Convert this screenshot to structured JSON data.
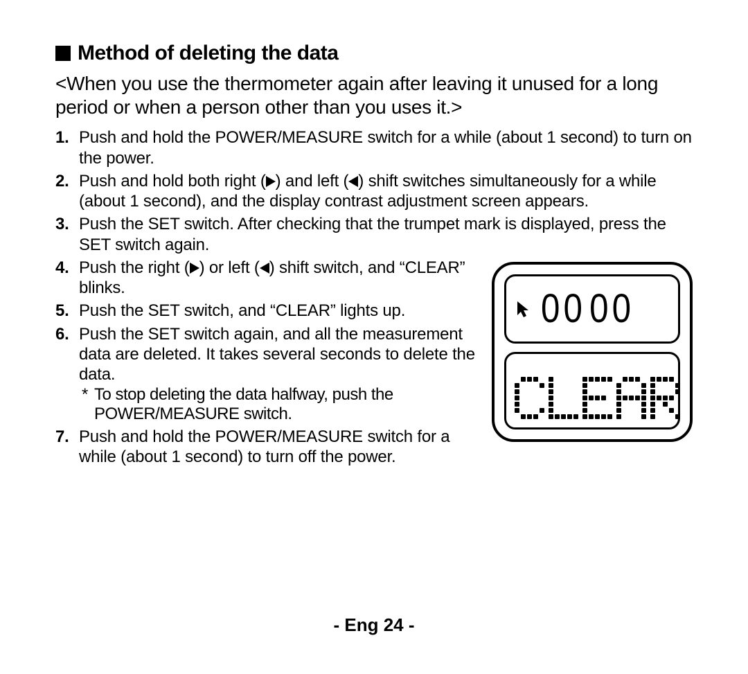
{
  "title": "Method of deleting the data",
  "intro": "<When you use the thermometer again after leaving it unused for a long period or when a person other than you uses it.>",
  "steps": {
    "s1": "Push and hold the POWER/MEASURE switch for a while (about 1 second) to turn on the power.",
    "s2a": "Push and hold both right (",
    "s2b": ") and left (",
    "s2c": ") shift switches simultaneously for a while (about 1 second), and the display contrast adjustment screen appears.",
    "s3": "Push the SET switch. After checking that the trumpet mark is displayed, press the SET switch again.",
    "s4a": "Push the right (",
    "s4b": ") or left (",
    "s4c": ") shift switch, and “CLEAR” blinks.",
    "s5": "Push the SET switch, and “CLEAR” lights up.",
    "s6": "Push the SET switch again, and all the measurement data are deleted. It takes several seconds to delete the data.",
    "s6_note": "To stop deleting the data halfway, push the POWER/MEASURE switch.",
    "s7": "Push and hold the POWER/MEASURE switch for a while (about 1 second) to turn off the power."
  },
  "lcd": {
    "top_digits_pair1": "00",
    "top_digits_pair2": "00",
    "bottom_text": "CLEAR"
  },
  "footer": "- Eng 24 -"
}
